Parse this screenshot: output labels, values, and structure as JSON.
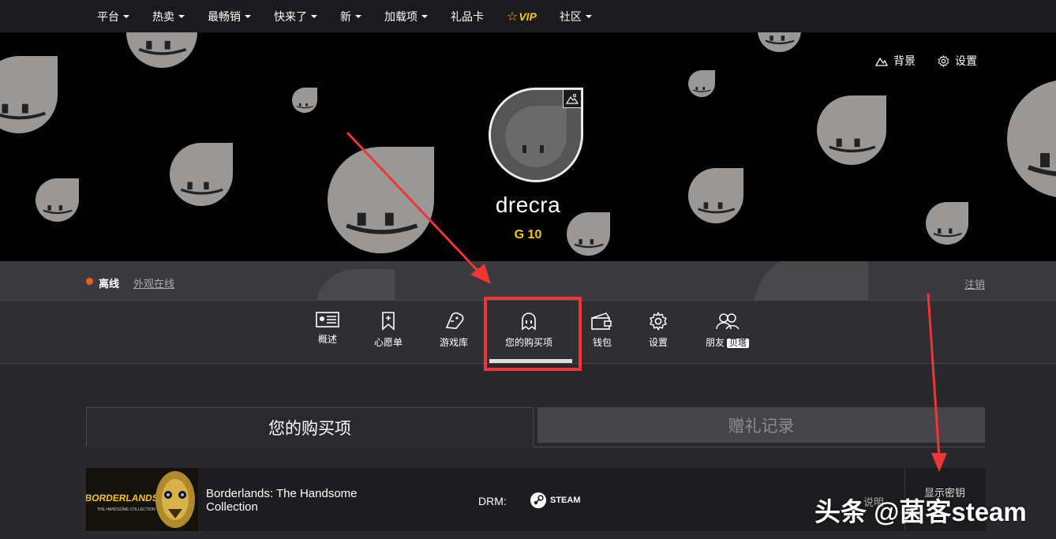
{
  "topnav": {
    "items": [
      {
        "label": "平台",
        "has_caret": true
      },
      {
        "label": "热卖",
        "has_caret": true
      },
      {
        "label": "最畅销",
        "has_caret": true
      },
      {
        "label": "快来了",
        "has_caret": true
      },
      {
        "label": "新",
        "has_caret": true
      },
      {
        "label": "加载项",
        "has_caret": true
      },
      {
        "label": "礼品卡",
        "has_caret": false
      },
      {
        "label": "VIP",
        "has_caret": false
      },
      {
        "label": "社区",
        "has_caret": true
      }
    ]
  },
  "hero": {
    "background_label": "背景",
    "settings_label": "设置",
    "username": "drecra",
    "level": "G 10"
  },
  "status": {
    "state": "离线",
    "appear_online": "外观在线",
    "logout": "注销",
    "dot_color": "#f35b1a"
  },
  "tabs": [
    {
      "label": "概述",
      "icon": "overview-icon"
    },
    {
      "label": "心愿单",
      "icon": "bookmark-icon"
    },
    {
      "label": "游戏库",
      "icon": "gamepad-icon"
    },
    {
      "label": "您的购买项",
      "icon": "ghost-icon",
      "active": true
    },
    {
      "label": "钱包",
      "icon": "wallet-icon"
    },
    {
      "label": "设置",
      "icon": "gear-icon"
    },
    {
      "label": "朋友",
      "icon": "friends-icon",
      "badge": "贝塔"
    }
  ],
  "subtabs": {
    "active": "您的购买项",
    "inactive": "赠礼记录"
  },
  "purchases": [
    {
      "title": "Borderlands: The Handsome Collection",
      "drm_label": "DRM:",
      "drm_platform": "STEAM",
      "info_link": "说明",
      "reveal_key": "显示密钥"
    }
  ],
  "watermark": "头条 @菌客steam",
  "colors": {
    "accent_yellow": "#f6c90e",
    "annotation_red": "#ee3636",
    "offline_orange": "#f35b1a"
  }
}
